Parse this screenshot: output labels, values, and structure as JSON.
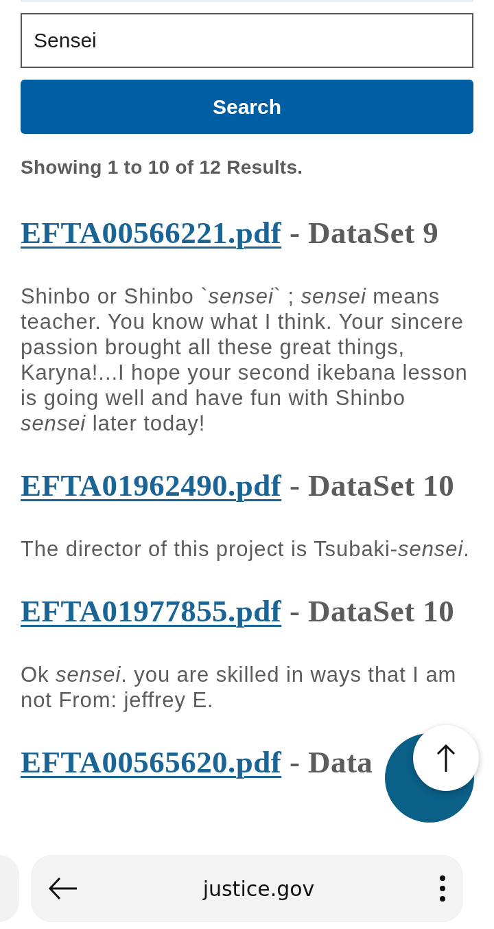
{
  "search": {
    "value": "Sensei"
  },
  "search_button": "Search",
  "summary": "Showing 1 to 10 of 12 Results.",
  "results": [
    {
      "file": "EFTA00566221.pdf",
      "dataset": "- DataSet 9",
      "snippet": "Shinbo or Shinbo `*sensei*` ; *sensei* means teacher. You know what I think. Your sincere passion brought all these great things, Karyna!...I hope your second ikebana lesson is going well and have fun with Shinbo *sensei* later today!"
    },
    {
      "file": "EFTA01962490.pdf",
      "dataset": "- DataSet 10",
      "snippet": "The director of this project is Tsubaki-*sensei*."
    },
    {
      "file": "EFTA01977855.pdf",
      "dataset": "- DataSet 10",
      "snippet": "Ok *sensei*. you are skilled in ways that I am not From: jeffrey E."
    },
    {
      "file": "EFTA00565620.pdf",
      "dataset": "- Data"
    }
  ],
  "browser_bar": {
    "url": "justice.gov"
  }
}
